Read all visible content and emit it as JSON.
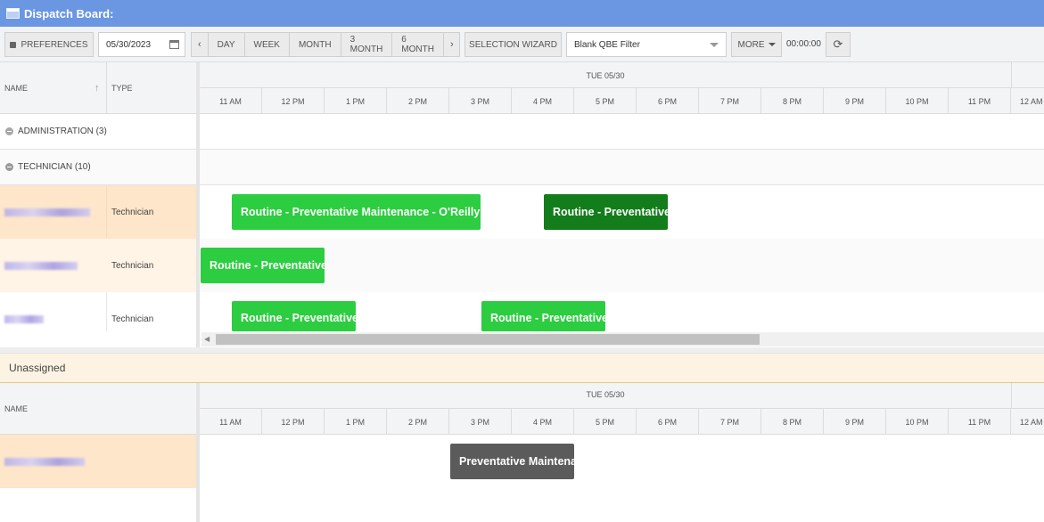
{
  "window": {
    "title": "Dispatch Board:"
  },
  "toolbar": {
    "preferences_label": "PREFERENCES",
    "date_value": "05/30/2023",
    "views": [
      "DAY",
      "WEEK",
      "MONTH",
      "3 MONTH",
      "6 MONTH"
    ],
    "selection_wizard_label": "SELECTION WIZARD",
    "filter_value": "Blank QBE Filter",
    "more_label": "MORE",
    "timer_value": "00:00:00"
  },
  "columns": {
    "name": "NAME",
    "type": "TYPE"
  },
  "timeline": {
    "day_label": "TUE 05/30",
    "hours": [
      "11 AM",
      "12 PM",
      "1 PM",
      "2 PM",
      "3 PM",
      "4 PM",
      "5 PM",
      "6 PM",
      "7 PM",
      "8 PM",
      "9 PM",
      "10 PM",
      "11 PM",
      "12 AM"
    ]
  },
  "groups": [
    {
      "label": "ADMINISTRATION (3)"
    },
    {
      "label": "TECHNICIAN (10)"
    }
  ],
  "technicians": [
    {
      "type": "Technician"
    },
    {
      "type": "Technician"
    },
    {
      "type": "Technician"
    }
  ],
  "events": [
    {
      "title": "Routine - Preventative Maintenance - O'Reilly"
    },
    {
      "title": "Routine - Preventative"
    },
    {
      "title": "Routine - Preventative"
    },
    {
      "title": "Routine - Preventative"
    },
    {
      "title": "Routine - Preventative"
    }
  ],
  "unassigned": {
    "title": "Unassigned",
    "name_header": "NAME",
    "event_title": "Preventative Maintenance"
  },
  "colors": {
    "titlebar": "#6a96e2",
    "event_light": "#2ccd40",
    "event_dark": "#127d1a",
    "event_grey": "#5b5b5b",
    "row_highlight": "#fde6c9"
  }
}
